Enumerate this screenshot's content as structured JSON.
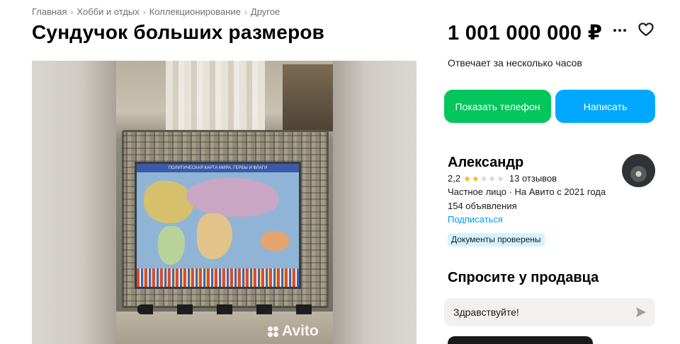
{
  "breadcrumb": [
    {
      "label": "Главная"
    },
    {
      "label": "Хобби и отдых"
    },
    {
      "label": "Коллекционирование"
    },
    {
      "label": "Другое"
    }
  ],
  "listing": {
    "title": "Сундучок больших размеров",
    "price": "1 001 000 000 ₽"
  },
  "gallery": {
    "watermark": "Avito",
    "map_caption": "ПОЛИТИЧЕСКАЯ КАРТА МИРА. ГЕРБЫ И ФЛАГИ"
  },
  "contact": {
    "response_time": "Отвечает за несколько часов",
    "show_phone_label": "Показать телефон",
    "write_label": "Написать"
  },
  "seller": {
    "name": "Александр",
    "rating": "2,2",
    "rating_value": 2.2,
    "stars_filled": 2,
    "stars_total": 5,
    "reviews": "13 отзывов",
    "type": "Частное лицо · На Авито с 2021 года",
    "ads_count": "154 объявления",
    "subscribe_label": "Подписаться",
    "docs_badge": "Документы проверены"
  },
  "ask": {
    "title": "Спросите у продавца",
    "message_value": "Здравствуйте!"
  },
  "icons": {
    "more": "more-dots-icon",
    "favorite": "heart-icon",
    "send": "send-arrow-icon",
    "star": "star-icon"
  },
  "colors": {
    "green_button": "#03c65c",
    "blue_button": "#00a9ff",
    "link": "#0099f7",
    "star": "#ffb021",
    "badge_bg": "#d4f3ff"
  }
}
